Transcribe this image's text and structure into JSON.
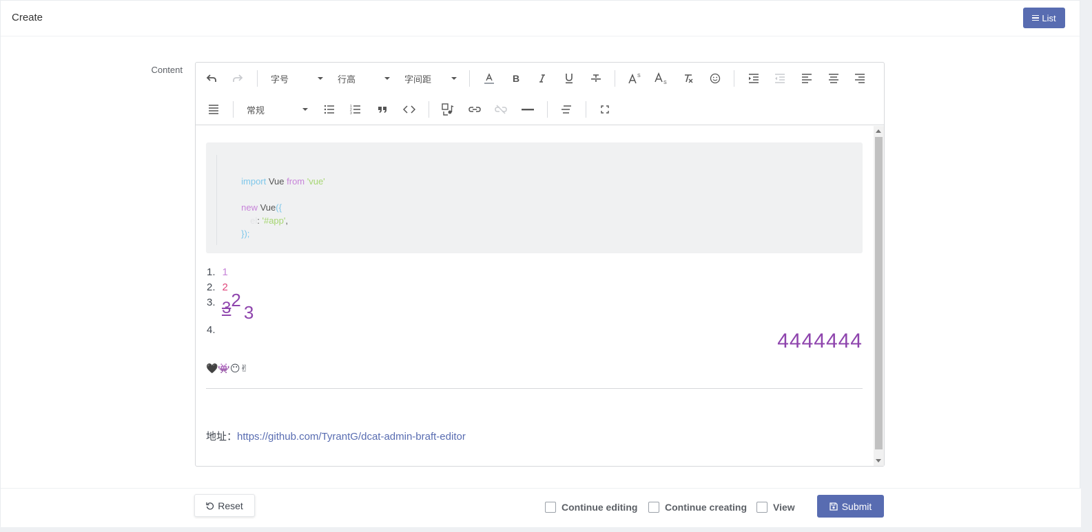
{
  "header": {
    "title": "Create",
    "list_button": "List"
  },
  "form": {
    "content_label": "Content",
    "toolbar": {
      "font_size_label": "字号",
      "line_height_label": "行高",
      "letter_spacing_label": "字间距",
      "block_type_label": "常规"
    },
    "editor": {
      "code": {
        "line1_import": "import",
        "line1_vue": " Vue ",
        "line1_from": "from",
        "line1_str": " 'vue'",
        "line2_new": "new",
        "line2_vue": " Vue",
        "line2_paren": "({",
        "line3_key": "el",
        "line3_sep": ": ",
        "line3_str": "'#app'",
        "line3_comma": ",",
        "line4": "});"
      },
      "list": {
        "n1": "1.",
        "v1": "1",
        "n2": "2.",
        "v2": "2",
        "n3": "3.",
        "v3_strike": "3",
        "v3_sup": "2",
        "v3_sub": "3",
        "n4": "4."
      },
      "big_number": "4444444",
      "emoji": "🖤👾😶✌",
      "address_label": "地址：",
      "address_url": "https://github.com/TyrantG/dcat-admin-braft-editor",
      "colors": {
        "list1": "#c784d9",
        "list2": "#e0457b",
        "purple": "#8e44ad",
        "link": "#586cb1"
      }
    }
  },
  "footer": {
    "reset": "Reset",
    "continue_editing": "Continue editing",
    "continue_creating": "Continue creating",
    "view": "View",
    "submit": "Submit"
  },
  "colors": {
    "primary": "#586cb1"
  }
}
